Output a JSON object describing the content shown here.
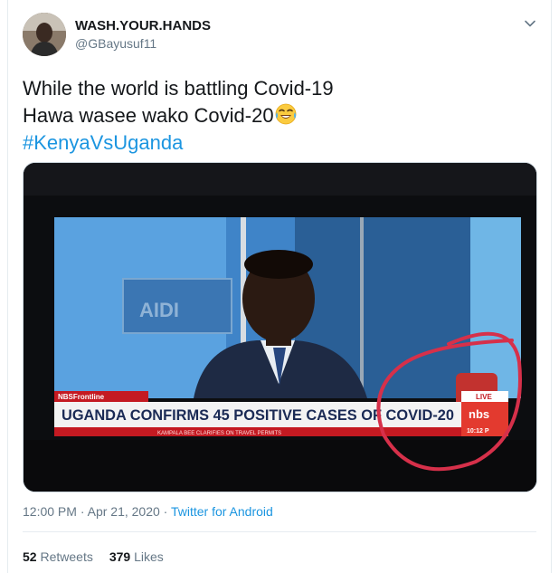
{
  "tweet": {
    "display_name": "WASH.YOUR.HANDS",
    "handle": "@GBayusuf11",
    "text_line1": "While the world is battling Covid-19",
    "text_line2": "Hawa wasee wako Covid-20",
    "hashtag": "#KenyaVsUganda",
    "time": "12:00 PM",
    "sep1": " · ",
    "date": "Apr 21, 2020",
    "sep2": " · ",
    "source": "Twitter for Android",
    "retweets_count": "52",
    "retweets_label": "Retweets",
    "likes_count": "379",
    "likes_label": "Likes"
  },
  "media": {
    "tv_label": "NBSFrontline",
    "headline": "UGANDA CONFIRMS 45 POSITIVE CASES OF COVID-20",
    "ticker": "KAMPALA BEE CLARIFIES ON TRAVEL PERMITS",
    "live": "LIVE",
    "channel": "nbs",
    "clock": "10:12 P",
    "studio_sign": "AIDI"
  },
  "icons": {
    "menu": "chevron-down-icon",
    "emoji": "face-with-tears-of-joy-emoji"
  },
  "colors": {
    "link": "#1b95e0",
    "secondary_text": "#657786",
    "primary_text": "#14171a",
    "highlight_circle": "#d6304a",
    "banner_red": "#c41a22"
  }
}
